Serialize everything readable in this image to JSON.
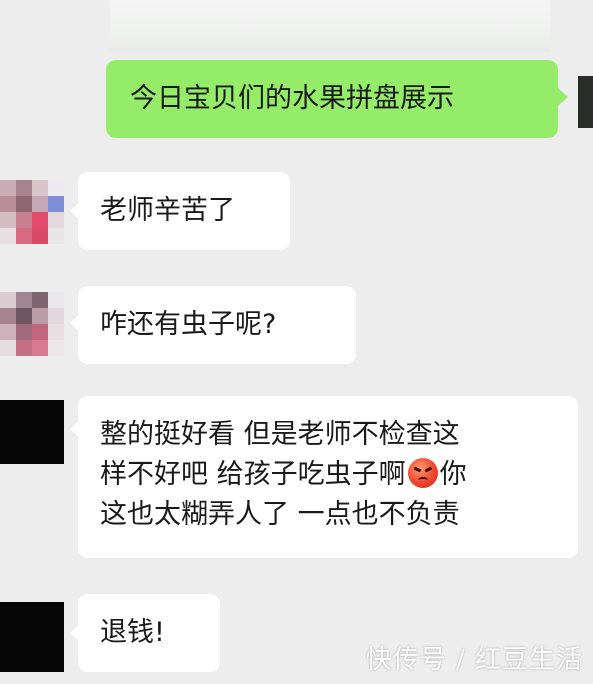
{
  "messages": [
    {
      "sender": "self",
      "text": "今日宝贝们的水果拼盘展示"
    },
    {
      "sender": "other",
      "text": "老师辛苦了"
    },
    {
      "sender": "other",
      "text": "咋还有虫子呢?"
    },
    {
      "sender": "other",
      "line1": "整的挺好看  但是老师不检查这",
      "line2a": "样不好吧 给孩子吃虫子啊",
      "emoji": "angry-face-emoji",
      "line2b": "你",
      "line3": "这也太糊弄人了  一点也不负责"
    },
    {
      "sender": "other",
      "text": "退钱!"
    }
  ],
  "watermark": "快传号 / 红豆生活",
  "colors": {
    "background": "#ededed",
    "incoming_bubble": "#ffffff",
    "outgoing_bubble": "#95ec69"
  }
}
